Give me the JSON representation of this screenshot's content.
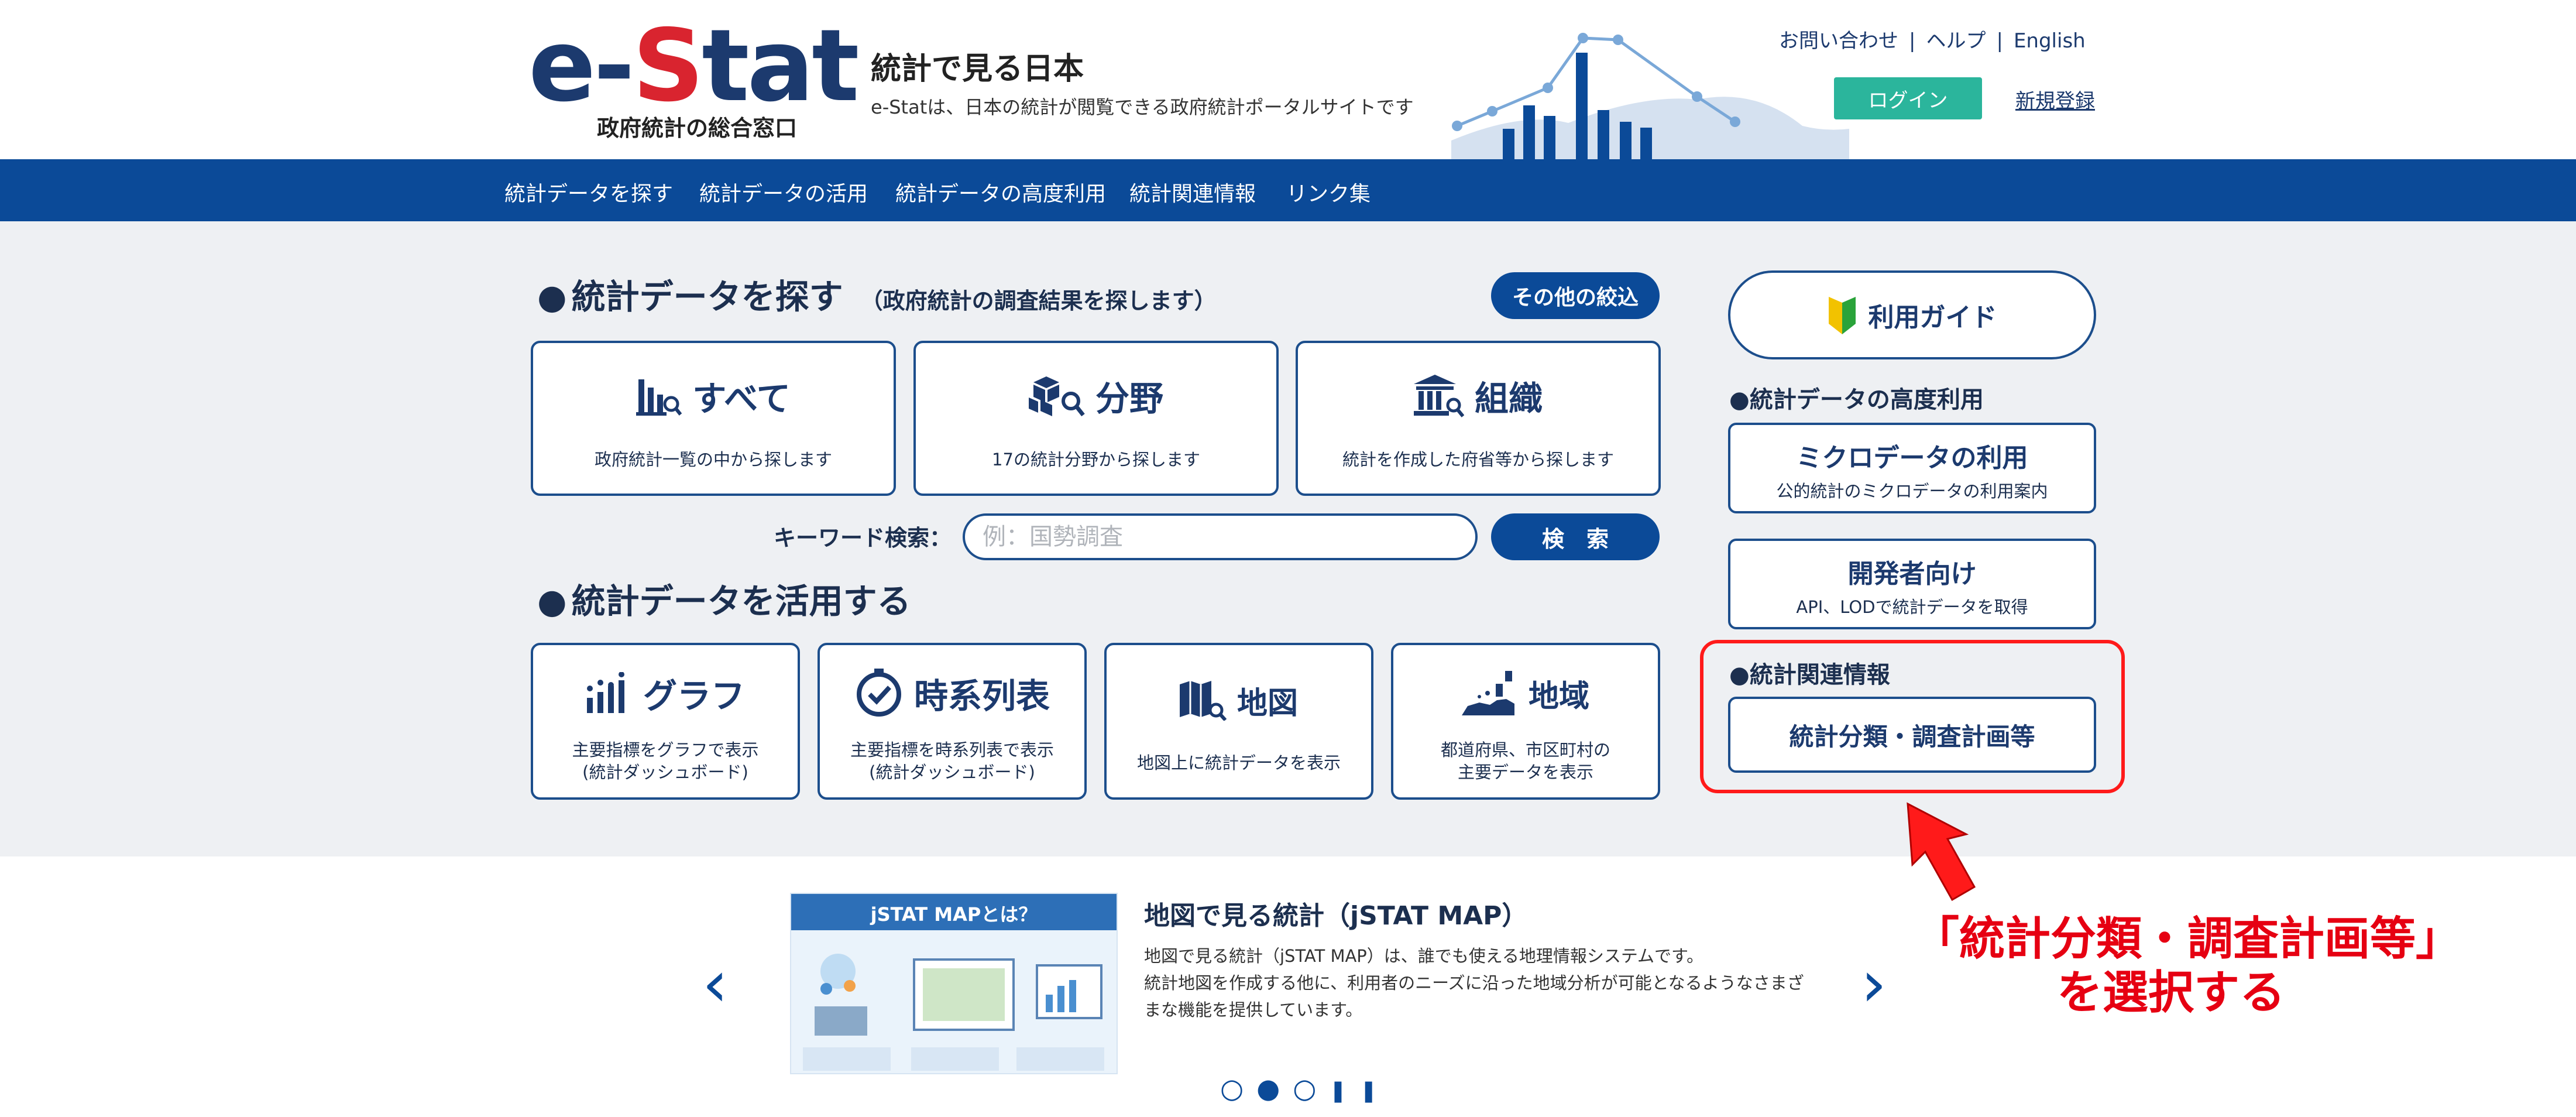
{
  "header": {
    "logo_text_e": "e-",
    "logo_text_s": "S",
    "logo_text_tat": "tat",
    "logo_sub": "政府統計の総合窓口",
    "tagline_title": "統計で見る日本",
    "tagline_desc": "e-Statは、日本の統計が閲覧できる政府統計ポータルサイトです",
    "links": {
      "contact": "お問い合わせ",
      "help": "ヘルプ",
      "english": "English",
      "separator": "|"
    },
    "login_label": "ログイン",
    "signup_label": "新規登録"
  },
  "nav": {
    "items": [
      "統計データを探す",
      "統計データの活用",
      "統計データの高度利用",
      "統計関連情報",
      "リンク集"
    ]
  },
  "search_section": {
    "bullet": "●",
    "title": "統計データを探す",
    "note": "（政府統計の調査結果を探します）",
    "filter_button": "その他の絞込",
    "cards": [
      {
        "label": "すべて",
        "desc": "政府統計一覧の中から探します",
        "icon": "bar-chart-search-icon"
      },
      {
        "label": "分野",
        "desc": "17の統計分野から探します",
        "icon": "cubes-search-icon"
      },
      {
        "label": "組織",
        "desc": "統計を作成した府省等から探します",
        "icon": "building-search-icon"
      }
    ],
    "keyword_label": "キーワード検索：",
    "keyword_placeholder": "例：国勢調査",
    "keyword_value": "",
    "search_button": "検　索"
  },
  "use_section": {
    "bullet": "●",
    "title": "統計データを活用する",
    "cards": [
      {
        "label": "グラフ",
        "desc1": "主要指標をグラフで表示",
        "desc2": "(統計ダッシュボード)",
        "icon": "graph-icon"
      },
      {
        "label": "時系列表",
        "desc1": "主要指標を時系列表で表示",
        "desc2": "(統計ダッシュボード)",
        "icon": "clock-check-icon"
      },
      {
        "label": "地図",
        "desc1": "地図上に統計データを表示",
        "desc2": "",
        "icon": "map-search-icon"
      },
      {
        "label": "地域",
        "desc1": "都道府県、市区町村の",
        "desc2": "主要データを表示",
        "icon": "region-chart-icon"
      }
    ]
  },
  "sidebar": {
    "guide_button": "利用ガイド",
    "advanced_heading": "●統計データの高度利用",
    "micro_title": "ミクロデータの利用",
    "micro_desc": "公的統計のミクロデータの利用案内",
    "dev_title": "開発者向け",
    "dev_desc": "API、LODで統計データを取得",
    "related_heading": "●統計関連情報",
    "classification_button": "統計分類・調査計画等"
  },
  "slider": {
    "image_title": "jSTAT MAPとは？",
    "title": "地図で見る統計（jSTAT MAP）",
    "body_lines": [
      "地図で見る統計（jSTAT MAP）は、誰でも使える地理情報システムです。",
      "統計地図を作成する他に、利用者のニーズに沿った地域分析が可能となるようなさまざ",
      "まな機能を提供しています。"
    ],
    "prev": "‹",
    "next": "›",
    "dots": [
      "○",
      "●",
      "○",
      "❚❚"
    ]
  },
  "annotation": {
    "line1": "「統計分類・調査計画等」",
    "line2": "を選択する",
    "color": "#e60012"
  },
  "colors": {
    "brand_blue": "#0b4a98",
    "accent_red": "#d9242f",
    "login_green": "#2bb59c",
    "bg_gray": "#eef0f3"
  }
}
